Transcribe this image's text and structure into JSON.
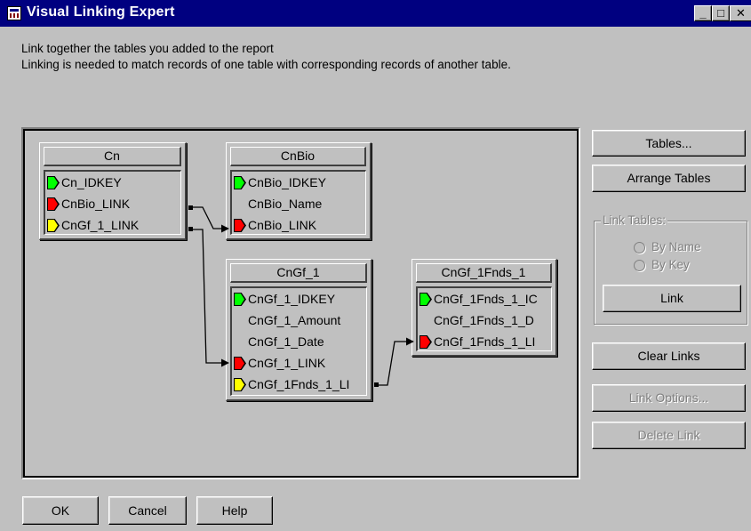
{
  "window": {
    "title": "Visual Linking Expert",
    "controls": {
      "minimize": "_",
      "maximize": "□",
      "close": "✕"
    }
  },
  "intro": {
    "line1": "Link together the tables you added to the report",
    "line2": "Linking is needed to match records of one table with corresponding records of another table."
  },
  "tables": {
    "cn": {
      "name": "Cn",
      "fields": [
        {
          "label": "Cn_IDKEY",
          "flag": "green"
        },
        {
          "label": "CnBio_LINK",
          "flag": "red"
        },
        {
          "label": "CnGf_1_LINK",
          "flag": "yellow"
        }
      ]
    },
    "cnbio": {
      "name": "CnBio",
      "fields": [
        {
          "label": "CnBio_IDKEY",
          "flag": "green"
        },
        {
          "label": "CnBio_Name",
          "flag": "none"
        },
        {
          "label": "CnBio_LINK",
          "flag": "red"
        }
      ]
    },
    "cngf1": {
      "name": "CnGf_1",
      "fields": [
        {
          "label": "CnGf_1_IDKEY",
          "flag": "green"
        },
        {
          "label": "CnGf_1_Amount",
          "flag": "none"
        },
        {
          "label": "CnGf_1_Date",
          "flag": "none"
        },
        {
          "label": "CnGf_1_LINK",
          "flag": "red"
        },
        {
          "label": "CnGf_1Fnds_1_LI",
          "flag": "yellow"
        }
      ]
    },
    "cngf1fnds1": {
      "name": "CnGf_1Fnds_1",
      "fields": [
        {
          "label": "CnGf_1Fnds_1_IC",
          "flag": "green"
        },
        {
          "label": "CnGf_1Fnds_1_D",
          "flag": "none"
        },
        {
          "label": "CnGf_1Fnds_1_LI",
          "flag": "red"
        }
      ]
    }
  },
  "sidebar": {
    "tables_button": "Tables...",
    "arrange_button": "Arrange Tables",
    "link_tables_group": "Link Tables:",
    "by_name": "By Name",
    "by_key": "By Key",
    "link_button": "Link",
    "clear_links_button": "Clear Links",
    "link_options_button": "Link Options...",
    "delete_link_button": "Delete Link"
  },
  "footer": {
    "ok_button": "OK",
    "cancel_button": "Cancel",
    "help_button": "Help"
  },
  "colors": {
    "titlebar": "#000080",
    "face": "#c0c0c0",
    "flag_green": "#00ff00",
    "flag_red": "#ff0000",
    "flag_yellow": "#ffff00"
  }
}
